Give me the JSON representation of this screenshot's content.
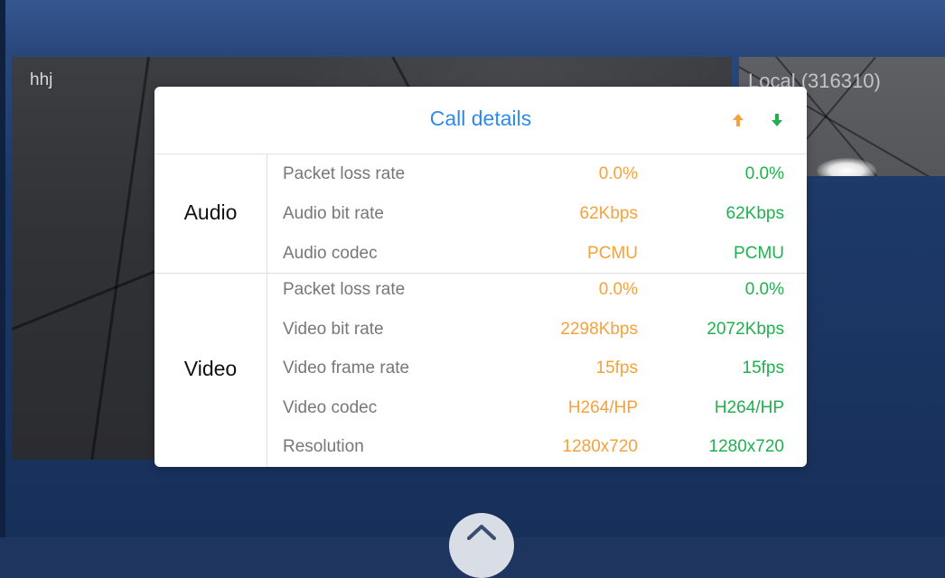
{
  "remote_participant": {
    "name": "hhj"
  },
  "local_participant": {
    "name": "Local (316310)"
  },
  "dialog": {
    "title": "Call details",
    "send_icon": "arrow-up-icon",
    "receive_icon": "arrow-down-icon",
    "colors": {
      "title": "#2f8be6",
      "send": "#f5a23b",
      "receive": "#1fb14d"
    }
  },
  "audio": {
    "label": "Audio",
    "rows": [
      {
        "name": "Packet loss rate",
        "send": "0.0%",
        "receive": "0.0%"
      },
      {
        "name": "Audio bit rate",
        "send": "62Kbps",
        "receive": "62Kbps"
      },
      {
        "name": "Audio codec",
        "send": "PCMU",
        "receive": "PCMU"
      }
    ]
  },
  "video": {
    "label": "Video",
    "rows": [
      {
        "name": "Packet loss rate",
        "send": "0.0%",
        "receive": "0.0%"
      },
      {
        "name": "Video bit rate",
        "send": "2298Kbps",
        "receive": "2072Kbps"
      },
      {
        "name": "Video frame rate",
        "send": "15fps",
        "receive": "15fps"
      },
      {
        "name": "Video codec",
        "send": "H264/HP",
        "receive": "H264/HP"
      },
      {
        "name": "Resolution",
        "send": "1280x720",
        "receive": "1280x720"
      }
    ]
  },
  "controls": {
    "expand_icon": "chevron-up-icon"
  }
}
